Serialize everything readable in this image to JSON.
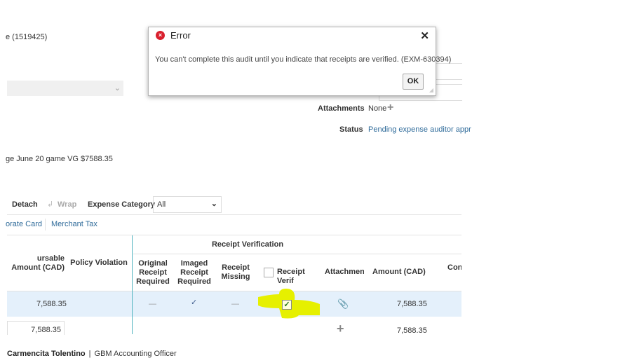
{
  "header": {
    "id_text": "e (1519425)",
    "description": "ge June 20 game VG $7588.35",
    "attachments_label": "Attachments",
    "attachments_value": "None",
    "status_label": "Status",
    "status_value": "Pending expense auditor appr"
  },
  "toolbar": {
    "detach": "Detach",
    "wrap": "Wrap",
    "expense_category_label": "Expense Category",
    "expense_category_value": "All"
  },
  "tabs": [
    {
      "label": "orate Card"
    },
    {
      "label": "Merchant Tax"
    }
  ],
  "table": {
    "group_header": "Receipt Verification",
    "columns": {
      "reimbursable": "ursable Amount (CAD)",
      "policy": "Policy Violation",
      "original": "Original Receipt Required",
      "imaged": "Imaged Receipt Required",
      "missing": "Receipt Missing",
      "verified": "Receipt Verif",
      "attachments": "Attachmen",
      "amount": "Amount (CAD)",
      "con": "Con"
    },
    "rows": [
      {
        "reimbursable": "7,588.35",
        "original": "—",
        "imaged": "✓",
        "missing": "—",
        "verified": true,
        "amount": "7,588.35"
      },
      {
        "reimbursable": "7,588.35",
        "amount": "7,588.35"
      }
    ]
  },
  "dialog": {
    "title": "Error",
    "message": "You can't complete this audit until you indicate that receipts are verified. (EXM-630394)",
    "ok": "OK"
  },
  "footer": {
    "user": "Carmencita Tolentino",
    "role": "GBM Accounting Officer"
  }
}
